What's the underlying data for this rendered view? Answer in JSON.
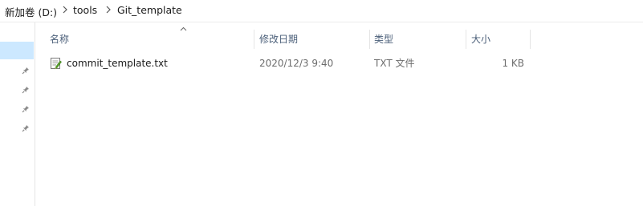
{
  "breadcrumb": {
    "items": [
      "新加卷 (D:)",
      "tools",
      "Git_template"
    ]
  },
  "icons": {
    "separator": "chevron-right-icon",
    "pin": "pin-icon",
    "file": "text-file-icon",
    "sort": "sort-up-icon"
  },
  "columns": {
    "name": "名称",
    "date": "修改日期",
    "type": "类型",
    "size": "大小"
  },
  "files": [
    {
      "name": "commit_template.txt",
      "date": "2020/12/3 9:40",
      "type": "TXT 文件",
      "size": "1 KB"
    }
  ],
  "colors": {
    "selection": "#cce8ff",
    "header_text": "#4c607a",
    "meta_text": "#6d6d6d"
  }
}
